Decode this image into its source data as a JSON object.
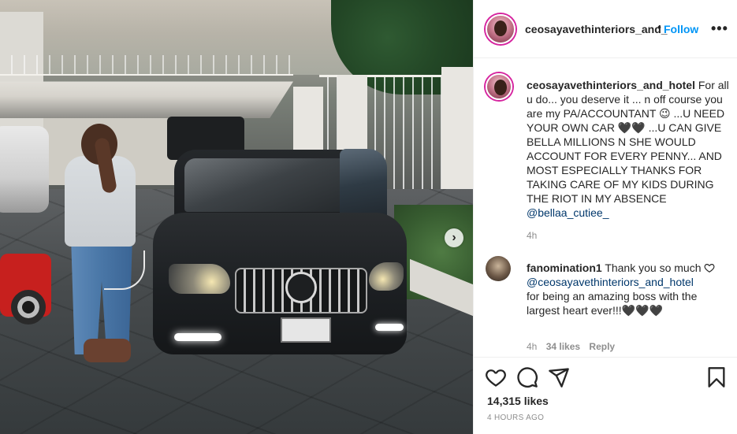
{
  "post": {
    "username": "ceosayavethinteriors_and_",
    "dot": "•",
    "follow_label": "Follow",
    "more_label": "•••"
  },
  "caption": {
    "username": "ceosayavethinteriors_and_hotel",
    "text": "For all u do... you deserve it ... n off course you are my PA/ACCOUNTANT 😉 ...U NEED YOUR OWN CAR 🖤🖤 ...U CAN GIVE BELLA MILLIONS N SHE WOULD ACCOUNT FOR EVERY PENNY... AND MOST ESPECIALLY THANKS FOR TAKING CARE OF MY KIDS DURING THE RIOT IN MY ABSENCE",
    "mention": "@bellaa_cutiee_",
    "time": "4h"
  },
  "comment": {
    "username": "fanomination1",
    "text_before": "Thank you so much",
    "mention": "@ceosayavethinteriors_and_hotel",
    "text_after": "for being an amazing boss with the largest heart ever!!!🖤🖤🖤",
    "time": "4h",
    "likes": "34 likes",
    "reply_label": "Reply"
  },
  "footer": {
    "likes_count": "14,315 likes",
    "time_ago": "4 HOURS AGO"
  },
  "icons": {
    "like": "heart-icon",
    "comment": "comment-bubble-icon",
    "share": "paper-plane-icon",
    "save": "bookmark-icon",
    "carousel_next": "chevron-right-icon",
    "more": "more-options-icon"
  },
  "colors": {
    "follow_blue": "#0095f6",
    "mention": "#00376b",
    "secondary_text": "#8e8e8e",
    "story_ring": "#d6249f"
  }
}
